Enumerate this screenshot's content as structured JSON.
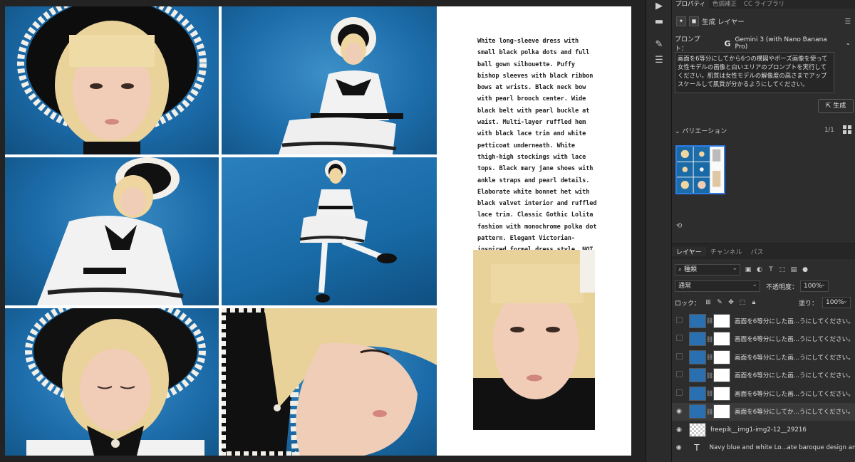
{
  "canvas": {
    "prompt_text": "White long-sleeve dress with small black polka dots and full ball gown silhouette. Puffy bishop sleeves with black ribbon bows at wrists. Black neck bow with pearl brooch center. Wide black belt with pearl buckle at waist. Multi-layer ruffled hem with black lace trim and white petticoat underneath. White thigh-high stockings with lace tops. Black mary jane shoes with ankle straps and pearl details. Elaborate white bonnet het with black valvet interior and ruffled lace trim. Classic Gothic Lolita fashion with monochrome polka dot pattern. Elegant Victorian-inspired formal dress style. NOT casual wear, NOT modern fashion, NOT colorful patterns."
  },
  "toolbar": {
    "icons": [
      "play-icon",
      "comment-icon",
      "brush-settings-icon",
      "adjust-icon"
    ]
  },
  "panel": {
    "tabs": [
      "プロパティ",
      "色調補正",
      "CC ライブラリ"
    ],
    "generative_layer_label": "生成 レイヤー",
    "prompt_label": "プロンプト：",
    "model_name": "Gemini 3 (with Nano Banana Pro)",
    "prompt_value": "画面を6等分にしてから6つの構図やポーズ画像を使って女性モデルの画像と白いエリアのプロンプトを実行してください。肌質は女性モデルの解像度の高さまでアップスケールして肌質が分かるようにしてください。",
    "generate_label": "生成",
    "variations_label": "バリエーション",
    "variation_count": "1/1"
  },
  "layers_panel": {
    "tabs": [
      "レイヤー",
      "チャンネル",
      "パス"
    ],
    "filter_kind": "種類",
    "blend_mode": "通常",
    "opacity_label": "不透明度：",
    "opacity_value": "100%",
    "lock_label": "ロック：",
    "fill_label": "塗り：",
    "fill_value": "100%",
    "layers": [
      {
        "name": "画面を6等分にした画...うにしてください。",
        "visible": false,
        "kind": "generative"
      },
      {
        "name": "画面を6等分にした画...うにしてください。",
        "visible": false,
        "kind": "generative"
      },
      {
        "name": "画面を6等分にした画...うにしてください。",
        "visible": false,
        "kind": "generative"
      },
      {
        "name": "画面を6等分にした画...うにしてください。",
        "visible": false,
        "kind": "generative"
      },
      {
        "name": "画面を6等分にした画...うにしてください。",
        "visible": false,
        "kind": "generative"
      },
      {
        "name": "画面を6等分にしてか...うにしてください。",
        "visible": true,
        "kind": "generative",
        "active": true
      },
      {
        "name": "freepik__img1-img2-12__29216",
        "visible": true,
        "kind": "pixel"
      },
      {
        "name": "Navy blue and white Lo...ate baroque design and",
        "visible": true,
        "kind": "text"
      }
    ]
  },
  "colors": {
    "panel_bg": "#2d2d2d",
    "backdrop_blue": "#1b6aa8",
    "selection_blue": "#2f7be6"
  }
}
